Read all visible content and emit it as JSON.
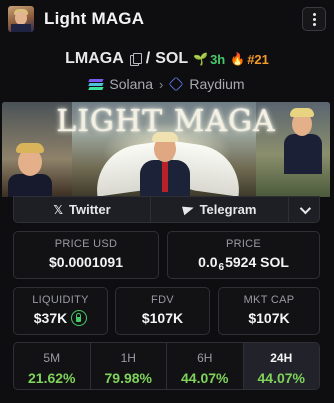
{
  "header": {
    "title": "Light MAGA"
  },
  "pair": {
    "base": "LMAGA",
    "separator": "/",
    "quote": "SOL",
    "age": "3h",
    "rank": "#21"
  },
  "chain": {
    "network": "Solana",
    "dex": "Raydium"
  },
  "banner": {
    "text": "LIGHT MAGA"
  },
  "social": {
    "twitter_label": "Twitter",
    "telegram_label": "Telegram"
  },
  "stats": {
    "price_usd_label": "PRICE USD",
    "price_usd_value": "$0.0001091",
    "price_label": "PRICE",
    "price_prefix": "0.0",
    "price_sub": "6",
    "price_suffix": "5924 SOL",
    "liquidity_label": "LIQUIDITY",
    "liquidity_value": "$37K",
    "fdv_label": "FDV",
    "fdv_value": "$107K",
    "mktcap_label": "MKT CAP",
    "mktcap_value": "$107K"
  },
  "performance": [
    {
      "timeframe": "5M",
      "change": "21.62%",
      "active": false
    },
    {
      "timeframe": "1H",
      "change": "79.98%",
      "active": false
    },
    {
      "timeframe": "6H",
      "change": "44.07%",
      "active": false
    },
    {
      "timeframe": "24H",
      "change": "44.07%",
      "active": true
    }
  ],
  "colors": {
    "positive": "#7fd35b",
    "age": "#47c96a",
    "rank": "#f39a2b",
    "background": "#0e0e10"
  }
}
